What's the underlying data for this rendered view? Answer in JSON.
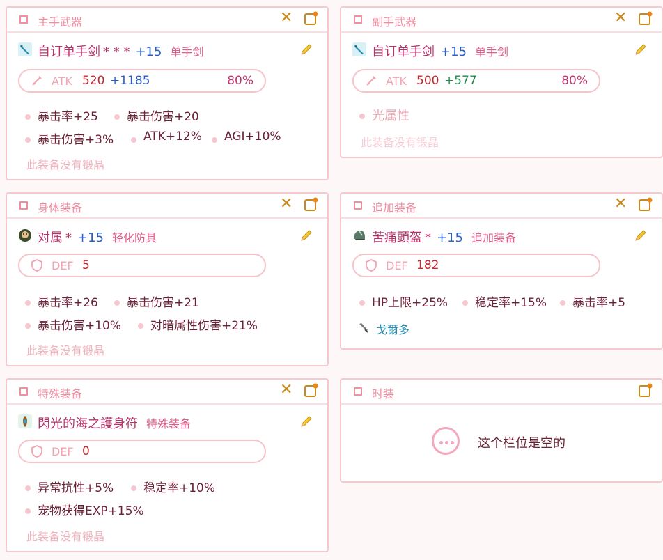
{
  "panels": {
    "main_weapon": {
      "header": "主手武器",
      "item_name": "自订单手剑",
      "stars": "* * *",
      "refine": "+15",
      "type": "单手剑",
      "stat_label": "ATK",
      "stat_value": "520",
      "stat_add": "+1185",
      "stat_pct": "80%",
      "attrs": [
        "暴击率+25",
        "暴击伤害+20",
        "暴击伤害+3%",
        "ATK+12%",
        "AGI+10%"
      ],
      "crystal_note": "此装备没有锻晶"
    },
    "sub_weapon": {
      "header": "副手武器",
      "item_name": "自订单手剑",
      "refine": "+15",
      "type": "单手剑",
      "stat_label": "ATK",
      "stat_value": "500",
      "stat_add": "+577",
      "stat_pct": "80%",
      "attrs": [
        "光属性"
      ],
      "crystal_note": "此装备没有锻晶"
    },
    "body_armor": {
      "header": "身体装备",
      "item_name": "对属",
      "stars": "*",
      "refine": "+15",
      "type": "轻化防具",
      "stat_label": "DEF",
      "stat_value": "5",
      "attrs": [
        "暴击率+26",
        "暴击伤害+21",
        "暴击伤害+10%",
        "对暗属性伤害+21%"
      ],
      "crystal_note": "此装备没有锻晶"
    },
    "additional": {
      "header": "追加装备",
      "item_name": "苦痛頭盔",
      "stars": "*",
      "refine": "+15",
      "type": "追加装备",
      "stat_label": "DEF",
      "stat_value": "182",
      "attrs": [
        "HP上限+25%",
        "稳定率+15%",
        "暴击率+5"
      ],
      "xtal": "戈爾多"
    },
    "special": {
      "header": "特殊装备",
      "item_name": "閃光的海之護身符",
      "type": "特殊装备",
      "stat_label": "DEF",
      "stat_value": "0",
      "attrs": [
        "异常抗性+5%",
        "稳定率+10%",
        "宠物获得EXP+15%"
      ],
      "crystal_note": "此装备没有锻晶"
    },
    "fashion": {
      "header": "时装",
      "empty_text": "这个栏位是空的"
    }
  },
  "icons": {
    "close": "close-icon",
    "edit": "edit-icon",
    "pencil": "pencil-icon",
    "sword": "sword-icon",
    "shield": "shield-icon"
  },
  "colors": {
    "accent_pink": "#ee8da0",
    "refine_blue": "#2a5fc7",
    "atk_red": "#c5282f",
    "add_green": "#1f8a4c",
    "close_orange": "#c98a1a"
  }
}
